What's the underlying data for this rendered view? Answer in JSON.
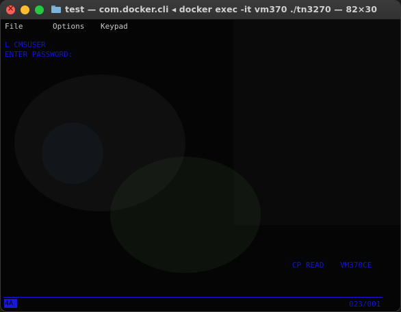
{
  "window": {
    "title": "test — com.docker.cli ◂ docker exec -it vm370 ./tn3270 — 82×30"
  },
  "menu": {
    "items": [
      "File",
      "Options",
      "Keypad"
    ]
  },
  "screen": {
    "line1": "L CMSUSER",
    "line2": "ENTER PASSWORD:",
    "status_cp": "CP READ",
    "status_system": "VM370CE",
    "oia_indicator": "4A",
    "cursor_position": "023/001"
  },
  "colors": {
    "terminal_text": "#1414d2",
    "close": "#ff5f57",
    "minimize": "#febc2e",
    "maximize": "#28c840"
  }
}
